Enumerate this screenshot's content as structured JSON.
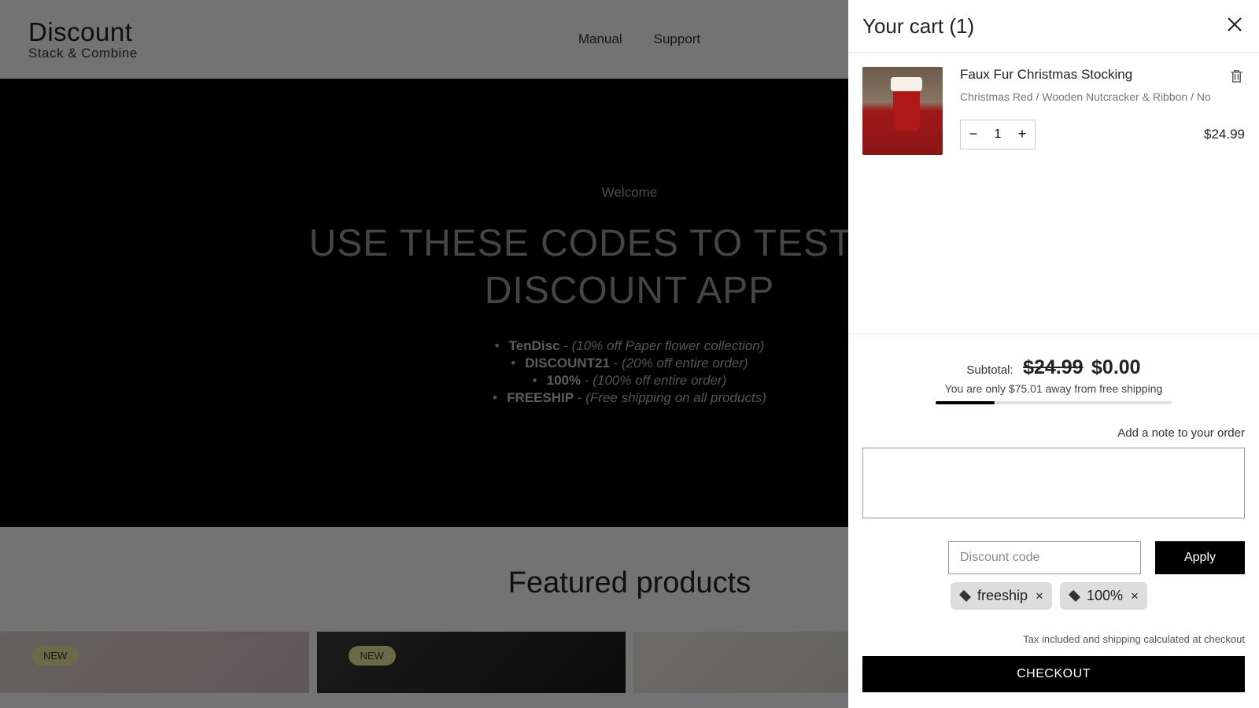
{
  "logo": {
    "main": "Discount",
    "sub": "Stack & Combine"
  },
  "nav": {
    "manual": "Manual",
    "support": "Support"
  },
  "hero": {
    "welcome": "Welcome",
    "title_line1": "USE THESE CODES TO TEST OUR",
    "title_line2": "DISCOUNT APP",
    "codes": [
      {
        "name": "TenDisc",
        "desc": "(10% off Paper flower collection)"
      },
      {
        "name": "DISCOUNT21",
        "desc": "(20% off entire order)"
      },
      {
        "name": "100%",
        "desc": "(100% off entire order)"
      },
      {
        "name": "FREESHIP",
        "desc": "(Free shipping on all products)"
      }
    ]
  },
  "featured": {
    "title": "Featured products"
  },
  "products": [
    {
      "badge": "NEW"
    },
    {
      "badge": "NEW"
    },
    {
      "badge": ""
    },
    {
      "badge": ""
    }
  ],
  "cart": {
    "title": "Your cart (1)",
    "items": [
      {
        "name": "Faux Fur Christmas Stocking",
        "variant": "Christmas Red / Wooden Nutcracker & Ribbon / No",
        "quantity": "1",
        "price": "$24.99"
      }
    ],
    "subtotal": {
      "label": "Subtotal:",
      "old": "$24.99",
      "new": "$0.00"
    },
    "shipping_msg": "You are only $75.01 away from free shipping",
    "progress_percent": 25,
    "note_label": "Add a note to your order",
    "note_value": "",
    "discount_placeholder": "Discount code",
    "apply_label": "Apply",
    "applied_tags": [
      {
        "label": "freeship"
      },
      {
        "label": "100%"
      }
    ],
    "tax_msg": "Tax included and shipping calculated at checkout",
    "checkout_label": "CHECKOUT"
  }
}
